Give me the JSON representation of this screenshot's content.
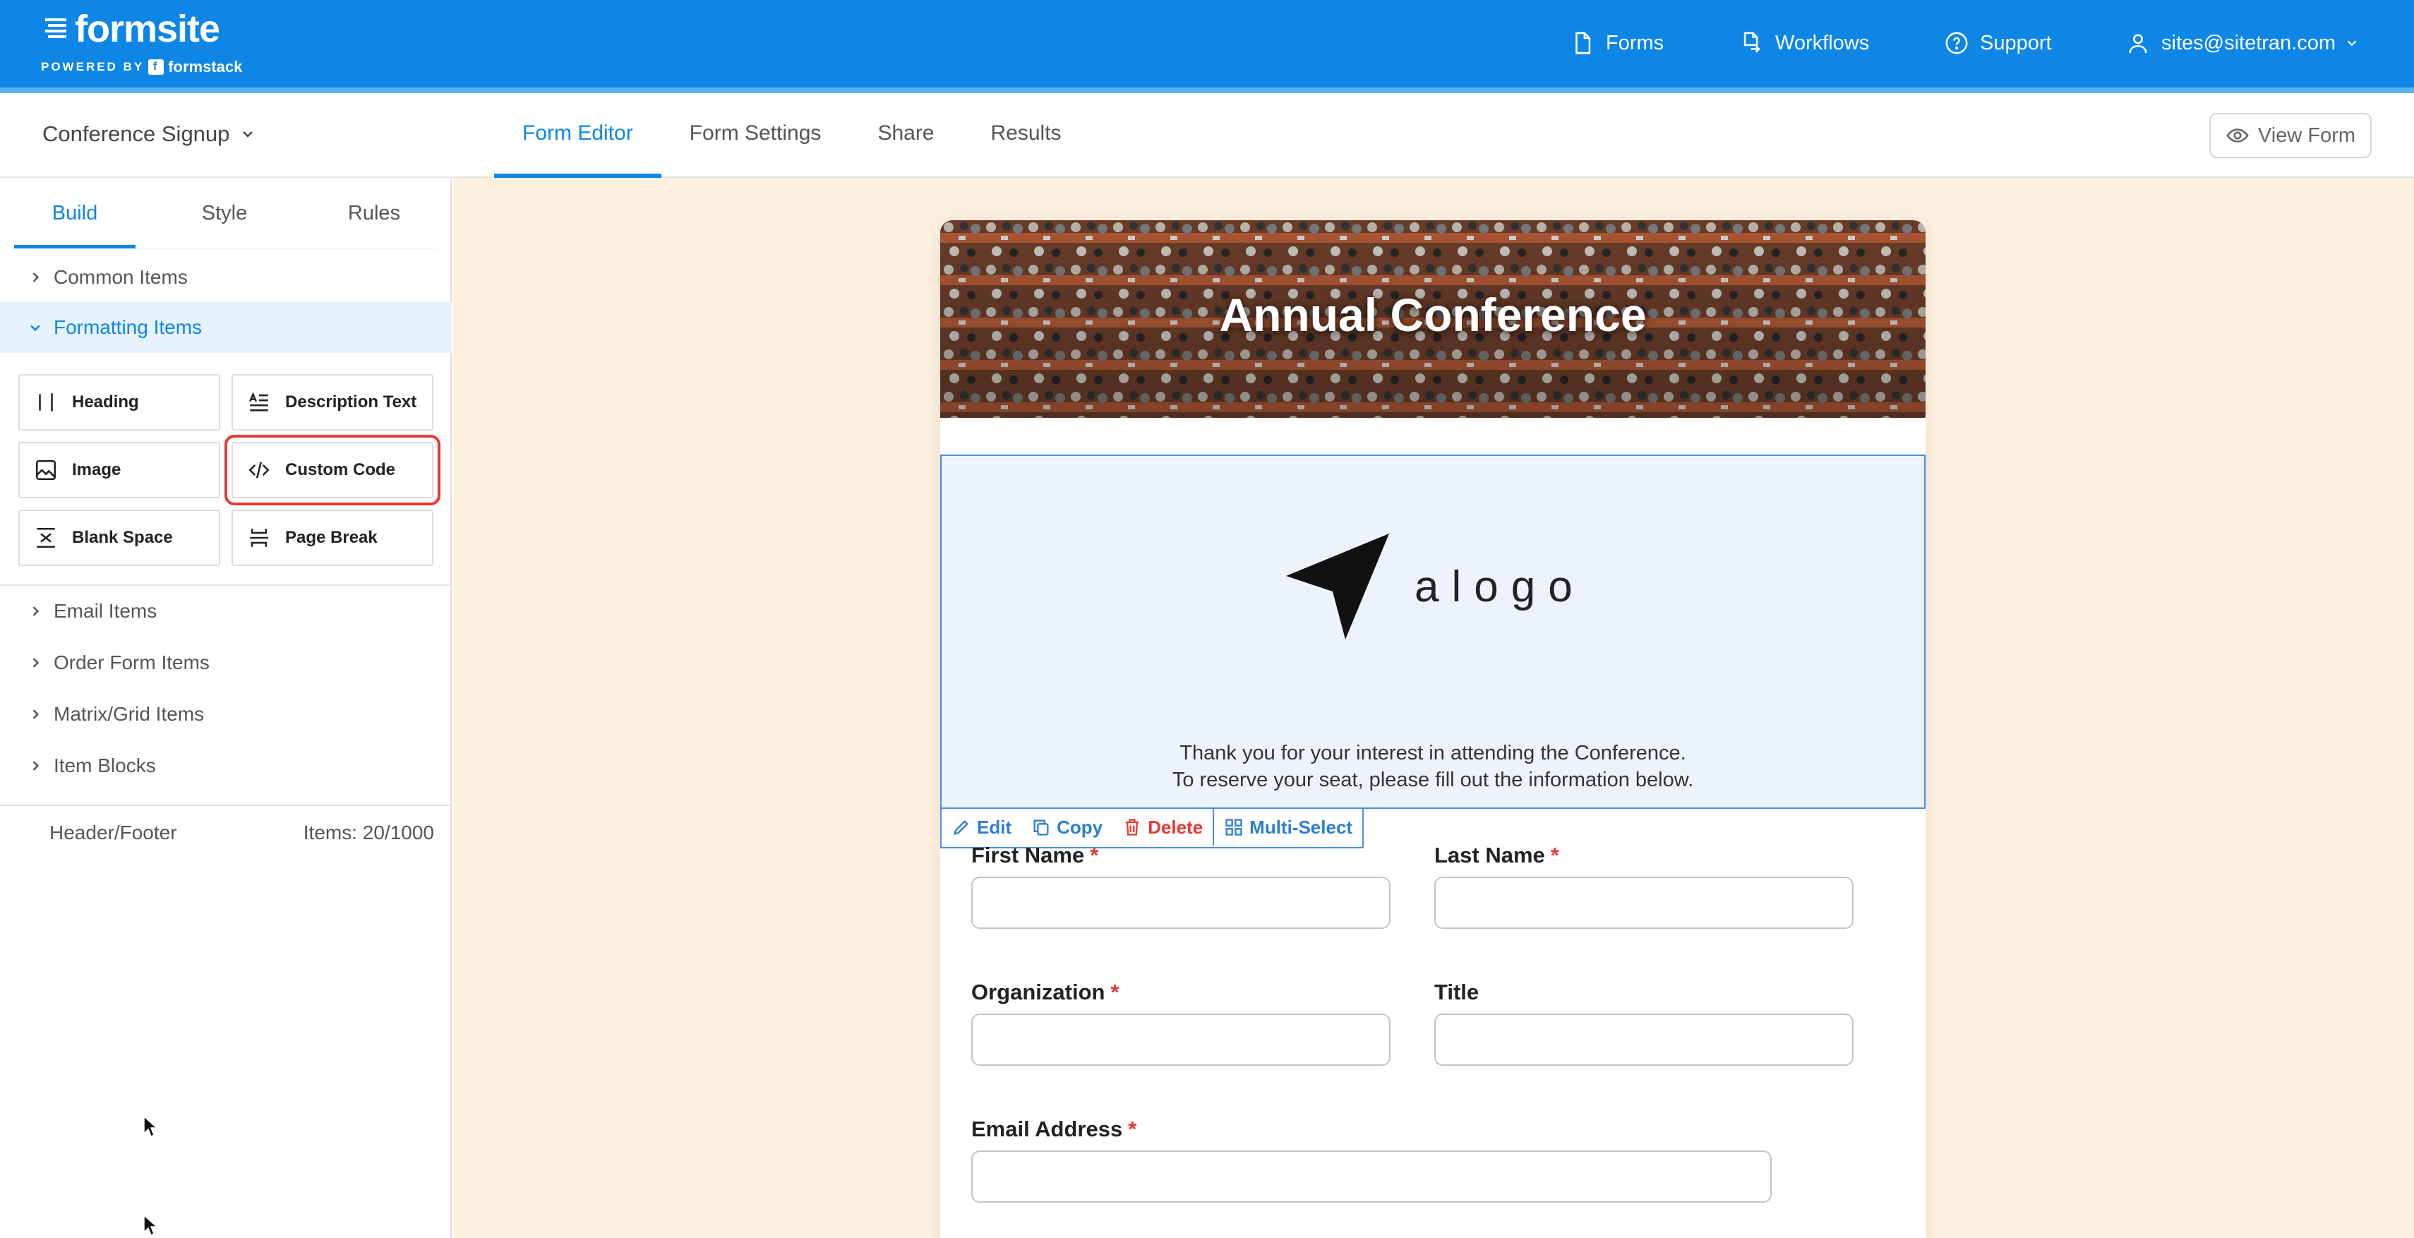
{
  "brand": {
    "name": "formsite",
    "powered_by": "POWERED BY",
    "partner": "formstack"
  },
  "top_nav": {
    "forms": "Forms",
    "workflows": "Workflows",
    "support": "Support",
    "user": "sites@sitetran.com"
  },
  "form_selector": "Conference Signup",
  "main_tabs": [
    {
      "label": "Form Editor",
      "active": true
    },
    {
      "label": "Form Settings",
      "active": false
    },
    {
      "label": "Share",
      "active": false
    },
    {
      "label": "Results",
      "active": false
    }
  ],
  "view_form": "View Form",
  "sidebar": {
    "tabs": [
      {
        "label": "Build",
        "active": true
      },
      {
        "label": "Style",
        "active": false
      },
      {
        "label": "Rules",
        "active": false
      }
    ],
    "categories": {
      "common": "Common Items",
      "formatting": "Formatting Items",
      "email": "Email Items",
      "order": "Order Form Items",
      "matrix": "Matrix/Grid Items",
      "blocks": "Item Blocks"
    },
    "formatting_items": {
      "heading": "Heading",
      "description": "Description Text",
      "image": "Image",
      "custom_code": "Custom Code",
      "blank_space": "Blank Space",
      "page_break": "Page Break"
    },
    "footer": {
      "header_footer": "Header/Footer",
      "items_count": "Items: 20/1000"
    }
  },
  "form": {
    "banner_title": "Annual Conference",
    "logo_text": "alogo",
    "description_line1": "Thank you for your interest in attending the Conference.",
    "description_line2": "To reserve your seat, please fill out the information below.",
    "toolbar": {
      "edit": "Edit",
      "copy": "Copy",
      "delete": "Delete",
      "multi_select": "Multi-Select"
    },
    "fields": {
      "first_name": "First Name",
      "last_name": "Last Name",
      "organization": "Organization",
      "title": "Title",
      "email": "Email Address"
    },
    "required_mark": "*"
  },
  "colors": {
    "brand_blue": "#0d86e6",
    "canvas_bg": "#fdf0de",
    "highlight_red": "#e53935",
    "selection_blue": "#4a90d9"
  }
}
